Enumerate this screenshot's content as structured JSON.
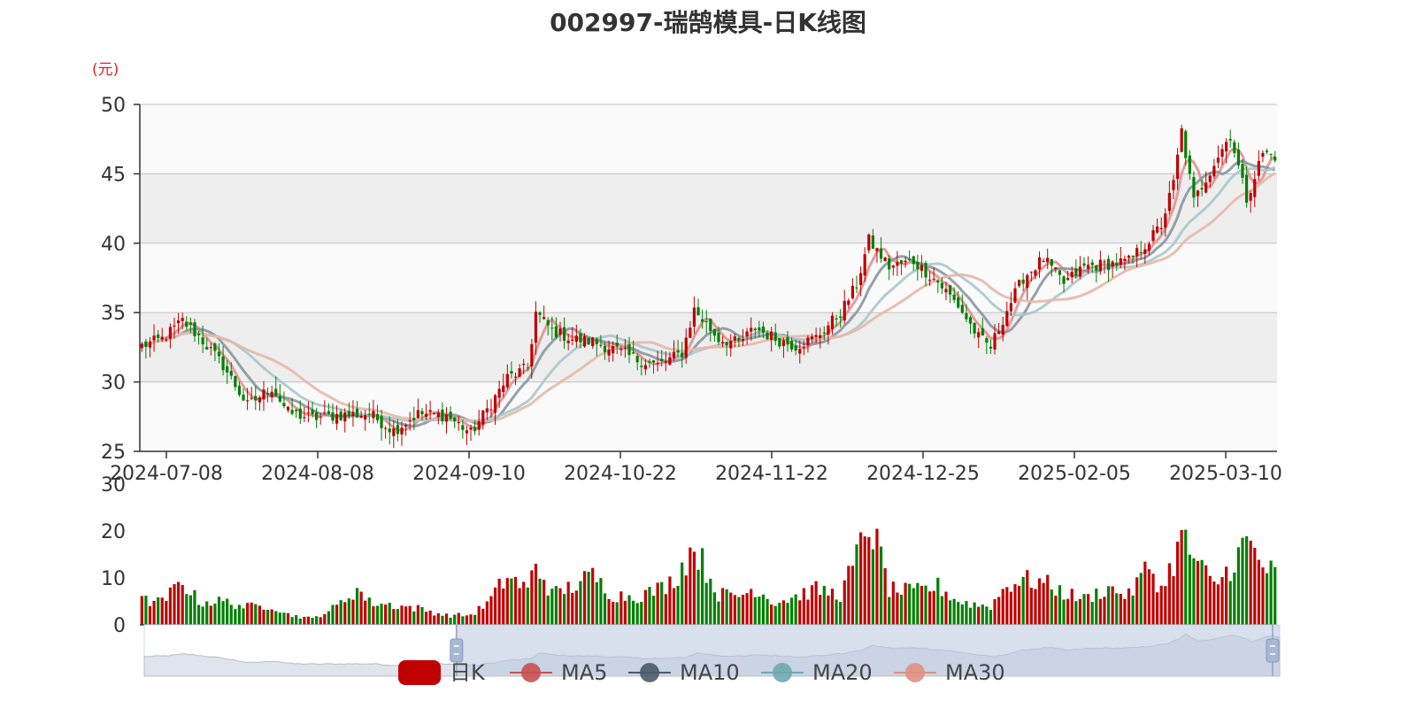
{
  "page": {
    "title": "002997-瑞鹄模具-日K线图"
  },
  "colors": {
    "up": "#c00000",
    "down": "#008000",
    "ma5": "#e39090",
    "ma10": "#8a96a0",
    "ma20": "#a8c8cc",
    "ma30": "#e6b8a8",
    "band_light": "#fafafa",
    "band_dark": "#eeeeee",
    "grid": "#c0c0c0",
    "axis": "#333333"
  },
  "chart_data": [
    {
      "type": "candlestick",
      "title": "002997-瑞鹄模具-日K线图",
      "y_unit": "(元)",
      "ylim": [
        25,
        50
      ],
      "y_ticks": [
        25,
        30,
        35,
        40,
        45,
        50
      ],
      "x_tick_labels": [
        "2024-07-08",
        "2024-08-08",
        "2024-09-10",
        "2024-10-22",
        "2024-11-22",
        "2024-12-25",
        "2025-02-05",
        "2025-03-10"
      ],
      "grid": "horizontal",
      "background_bands": true,
      "close_anchors": [
        [
          0,
          32.6
        ],
        [
          5,
          33.1
        ],
        [
          10,
          34.4
        ],
        [
          14,
          33.3
        ],
        [
          20,
          31.2
        ],
        [
          26,
          28.3
        ],
        [
          32,
          29.6
        ],
        [
          36,
          27.8
        ],
        [
          42,
          27.4
        ],
        [
          48,
          27.6
        ],
        [
          56,
          27.7
        ],
        [
          62,
          26.5
        ],
        [
          68,
          27.7
        ],
        [
          75,
          27.6
        ],
        [
          81,
          26.3
        ],
        [
          85,
          28.0
        ],
        [
          90,
          30.3
        ],
        [
          95,
          31.0
        ],
        [
          97,
          35.0
        ],
        [
          101,
          33.7
        ],
        [
          106,
          33.1
        ],
        [
          111,
          32.9
        ],
        [
          116,
          32.4
        ],
        [
          122,
          31.6
        ],
        [
          127,
          31.2
        ],
        [
          133,
          32.1
        ],
        [
          136,
          35.2
        ],
        [
          142,
          33.1
        ],
        [
          147,
          32.8
        ],
        [
          151,
          33.9
        ],
        [
          156,
          33.1
        ],
        [
          161,
          32.6
        ],
        [
          166,
          33.2
        ],
        [
          172,
          35.0
        ],
        [
          176,
          37.0
        ],
        [
          179,
          40.2
        ],
        [
          184,
          38.3
        ],
        [
          190,
          38.7
        ],
        [
          196,
          37.2
        ],
        [
          201,
          35.5
        ],
        [
          206,
          33.2
        ],
        [
          209,
          32.5
        ],
        [
          213,
          35.2
        ],
        [
          217,
          37.5
        ],
        [
          222,
          38.9
        ],
        [
          227,
          37.1
        ],
        [
          232,
          38.3
        ],
        [
          238,
          38.5
        ],
        [
          243,
          38.7
        ],
        [
          248,
          40.2
        ],
        [
          251,
          41.3
        ],
        [
          254,
          44.3
        ],
        [
          256,
          48.1
        ],
        [
          259,
          43.0
        ],
        [
          264,
          45.8
        ],
        [
          268,
          47.8
        ],
        [
          272,
          43.2
        ],
        [
          276,
          46.5
        ],
        [
          279,
          46.3
        ]
      ],
      "ma_series": [
        {
          "name": "MA5",
          "window": 5
        },
        {
          "name": "MA10",
          "window": 10
        },
        {
          "name": "MA20",
          "window": 20
        },
        {
          "name": "MA30",
          "window": 30
        }
      ],
      "num_days": 280
    },
    {
      "type": "bar",
      "title": "",
      "ylim": [
        0,
        30
      ],
      "y_ticks": [
        0,
        10,
        20,
        30
      ],
      "volume_anchors": [
        [
          0,
          5.2
        ],
        [
          5,
          4.8
        ],
        [
          10,
          9.3
        ],
        [
          14,
          4.9
        ],
        [
          20,
          5.0
        ],
        [
          26,
          3.8
        ],
        [
          32,
          4.2
        ],
        [
          36,
          2.2
        ],
        [
          42,
          1.3
        ],
        [
          48,
          3.9
        ],
        [
          53,
          7.7
        ],
        [
          56,
          4.8
        ],
        [
          62,
          4.2
        ],
        [
          68,
          3.5
        ],
        [
          75,
          2.0
        ],
        [
          81,
          2.1
        ],
        [
          85,
          4.5
        ],
        [
          90,
          10.4
        ],
        [
          95,
          7.5
        ],
        [
          97,
          13.1
        ],
        [
          101,
          6.5
        ],
        [
          106,
          8.2
        ],
        [
          111,
          10.4
        ],
        [
          116,
          6.3
        ],
        [
          122,
          6.1
        ],
        [
          127,
          7.5
        ],
        [
          131,
          9.5
        ],
        [
          136,
          16.8
        ],
        [
          142,
          6.5
        ],
        [
          147,
          6.2
        ],
        [
          151,
          7.8
        ],
        [
          156,
          4.7
        ],
        [
          161,
          6.1
        ],
        [
          166,
          7.5
        ],
        [
          172,
          6.4
        ],
        [
          176,
          14.3
        ],
        [
          179,
          22.1
        ],
        [
          182,
          14.2
        ],
        [
          184,
          7.5
        ],
        [
          190,
          7.0
        ],
        [
          196,
          8.2
        ],
        [
          201,
          5.0
        ],
        [
          206,
          4.2
        ],
        [
          209,
          4.0
        ],
        [
          213,
          8.5
        ],
        [
          217,
          9.6
        ],
        [
          222,
          9.0
        ],
        [
          227,
          6.8
        ],
        [
          232,
          5.5
        ],
        [
          238,
          7.8
        ],
        [
          243,
          6.2
        ],
        [
          248,
          12.7
        ],
        [
          251,
          7.5
        ],
        [
          254,
          13.5
        ],
        [
          256,
          18.7
        ],
        [
          259,
          14.3
        ],
        [
          264,
          8.2
        ],
        [
          268,
          12.3
        ],
        [
          272,
          17.8
        ],
        [
          276,
          12.5
        ],
        [
          279,
          10.8
        ]
      ]
    }
  ],
  "legend": {
    "items": [
      {
        "label": "日K",
        "color": "#c00000",
        "shape": "rounded-rect",
        "icon": "candle-legend-icon"
      },
      {
        "label": "MA5",
        "color": "#c85050",
        "shape": "line-circle",
        "icon": "line-legend-icon"
      },
      {
        "label": "MA10",
        "color": "#4a5a6a",
        "shape": "line-circle",
        "icon": "line-legend-icon"
      },
      {
        "label": "MA20",
        "color": "#70a8b0",
        "shape": "line-circle",
        "icon": "line-legend-icon"
      },
      {
        "label": "MA30",
        "color": "#e09080",
        "shape": "line-circle",
        "icon": "line-legend-icon"
      }
    ]
  },
  "datazoom": {
    "range_start_percent": 27.5,
    "range_end_percent": 100,
    "handle_icon": "drag-handle-icon"
  }
}
